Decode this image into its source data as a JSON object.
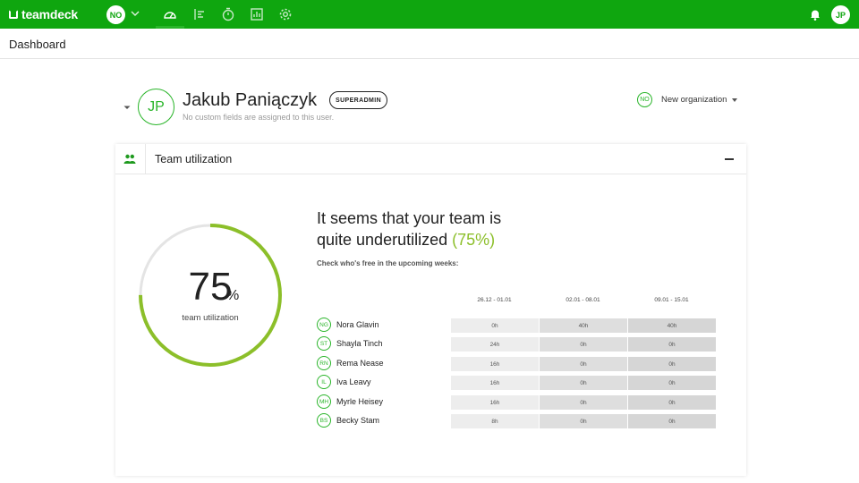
{
  "app": {
    "logo_text": "teamdeck",
    "org_initials": "NO",
    "user_initials": "JP",
    "brand_color": "#0fa60f",
    "accent_color": "#8cbf2a"
  },
  "nav": {
    "icons": [
      "dashboard-icon",
      "planner-icon",
      "timer-icon",
      "reports-icon",
      "settings-icon"
    ],
    "active": "dashboard-icon"
  },
  "page": {
    "title": "Dashboard"
  },
  "profile": {
    "initials": "JP",
    "name": "Jakub Paniączyk",
    "role": "SUPERADMIN",
    "subtext": "No custom fields are assigned to this user.",
    "org_initials": "NO",
    "org_name": "New organization"
  },
  "card": {
    "title": "Team utilization",
    "utilization_value": "75",
    "utilization_fraction": 0.75,
    "utilization_unit": "%",
    "utilization_label": "team utilization",
    "headline_1": "It seems that your team is",
    "headline_2": "quite underutilized",
    "headline_accent": "(75%)",
    "subline": "Check who's free in the upcoming weeks:",
    "weeks": [
      "26.12 - 01.01",
      "02.01 - 08.01",
      "09.01 - 15.01"
    ],
    "people": [
      {
        "initials": "NG",
        "name": "Nora Glavin",
        "hours": [
          "0h",
          "40h",
          "40h"
        ]
      },
      {
        "initials": "ST",
        "name": "Shayla Tinch",
        "hours": [
          "24h",
          "0h",
          "0h"
        ]
      },
      {
        "initials": "RN",
        "name": "Rema Nease",
        "hours": [
          "16h",
          "0h",
          "0h"
        ]
      },
      {
        "initials": "IL",
        "name": "Iva Leavy",
        "hours": [
          "16h",
          "0h",
          "0h"
        ]
      },
      {
        "initials": "MH",
        "name": "Myrle Heisey",
        "hours": [
          "16h",
          "0h",
          "0h"
        ]
      },
      {
        "initials": "BS",
        "name": "Becky Stam",
        "hours": [
          "8h",
          "0h",
          "0h"
        ]
      }
    ]
  }
}
